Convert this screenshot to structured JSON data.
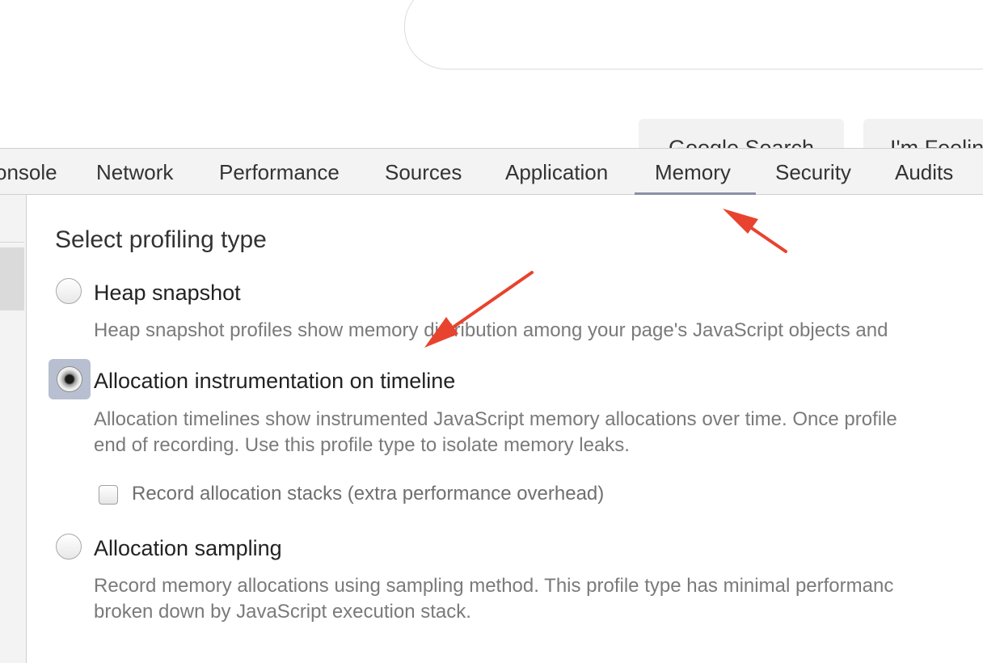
{
  "background_page": {
    "search_button": "Google Search",
    "lucky_button": "I'm Feeling"
  },
  "tabs": [
    "onsole",
    "Network",
    "Performance",
    "Sources",
    "Application",
    "Memory",
    "Security",
    "Audits"
  ],
  "active_tab": "Memory",
  "panel": {
    "title": "Select profiling type",
    "options": [
      {
        "label": "Heap snapshot",
        "desc": [
          "Heap snapshot profiles show memory distribution among your page's JavaScript objects and"
        ],
        "selected": false
      },
      {
        "label": "Allocation instrumentation on timeline",
        "desc": [
          "Allocation timelines show instrumented JavaScript memory allocations over time. Once profile",
          "end of recording. Use this profile type to isolate memory leaks."
        ],
        "selected": true
      },
      {
        "label": "Allocation sampling",
        "desc": [
          "Record memory allocations using sampling method. This profile type has minimal performanc",
          "broken down by JavaScript execution stack."
        ],
        "selected": false
      }
    ],
    "checkbox_label": "Record allocation stacks (extra performance overhead)",
    "checkbox_checked": false
  },
  "colors": {
    "annotation_arrow": "#e8432e",
    "tab_underline": "#8a8fa5",
    "focus_ring": "#b8bfd0"
  }
}
